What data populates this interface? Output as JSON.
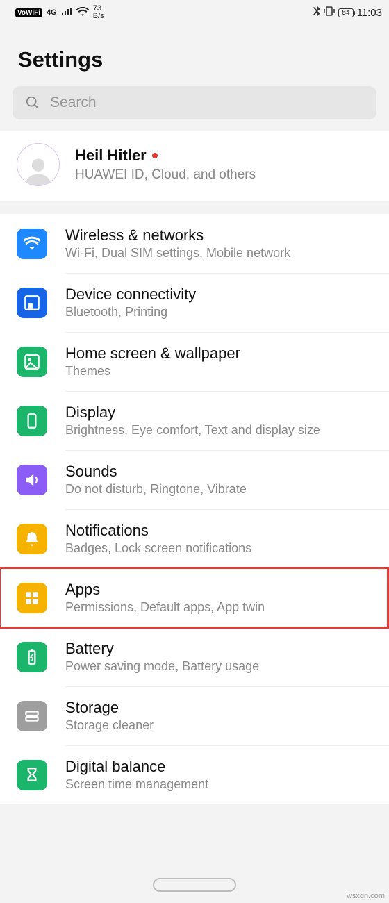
{
  "status": {
    "vowifi": "VoWiFi",
    "net": "4G",
    "speed_top": "73",
    "speed_bot": "B/s",
    "battery": "54",
    "time": "11:03"
  },
  "header": {
    "title": "Settings"
  },
  "search": {
    "placeholder": "Search"
  },
  "account": {
    "name": "Heil Hitler",
    "sub": "HUAWEI ID, Cloud, and others"
  },
  "items": [
    {
      "title": "Wireless & networks",
      "sub": "Wi-Fi, Dual SIM settings, Mobile network"
    },
    {
      "title": "Device connectivity",
      "sub": "Bluetooth, Printing"
    },
    {
      "title": "Home screen & wallpaper",
      "sub": "Themes"
    },
    {
      "title": "Display",
      "sub": "Brightness, Eye comfort, Text and display size"
    },
    {
      "title": "Sounds",
      "sub": "Do not disturb, Ringtone, Vibrate"
    },
    {
      "title": "Notifications",
      "sub": "Badges, Lock screen notifications"
    },
    {
      "title": "Apps",
      "sub": "Permissions, Default apps, App twin"
    },
    {
      "title": "Battery",
      "sub": "Power saving mode, Battery usage"
    },
    {
      "title": "Storage",
      "sub": "Storage cleaner"
    },
    {
      "title": "Digital balance",
      "sub": "Screen time management"
    }
  ],
  "watermark": "wsxdn.com"
}
